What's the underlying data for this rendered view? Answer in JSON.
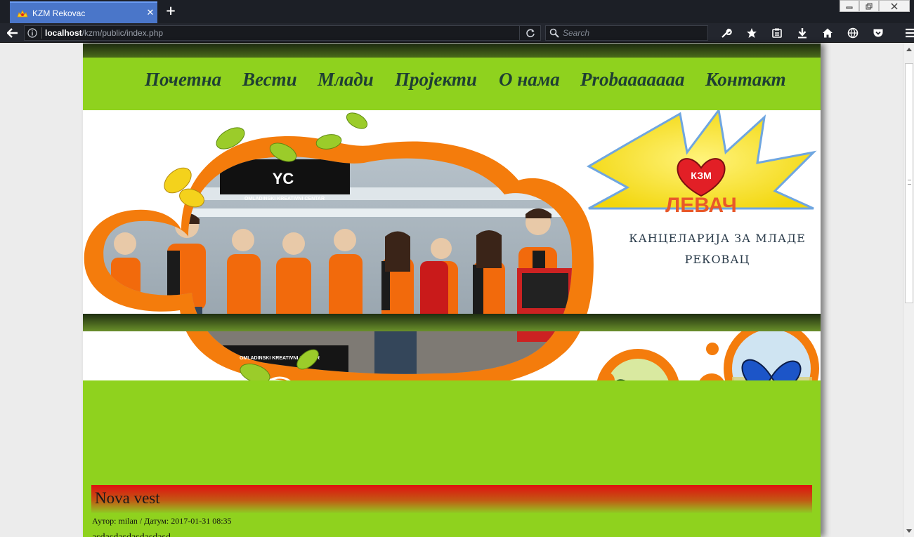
{
  "browser": {
    "tab_title": "KZM Rekovac",
    "url_host": "localhost",
    "url_path": "/kzm/public/index.php",
    "search_placeholder": "Search"
  },
  "site": {
    "menu": [
      "Почетна",
      "Вести",
      "Млади",
      "Пројекти",
      "О нама",
      "Probaaaaaaa",
      "Контакт"
    ],
    "banner": {
      "booth_sign": "OMLADINSKI KREATIVNI CENTAR",
      "booth_logo": "YC",
      "logo_heart": "КЗМ",
      "logo_word": "ЛЕВАЧ",
      "office_line1": "КАНЦЕЛАРИЈА ЗА МЛАДЕ",
      "office_line2": "РЕКОВАЦ"
    },
    "news": {
      "title": "Nova vest",
      "meta": "Аутор: milan / Датум: 2017-01-31 08:35",
      "body": "asdasdasdasdasdasd"
    }
  },
  "colors": {
    "page_green": "#8fd21e",
    "menu_text": "#1f3f33",
    "accent_orange": "#f47c0c",
    "news_red": "#e01010",
    "tab_blue": "#4a76c9"
  }
}
